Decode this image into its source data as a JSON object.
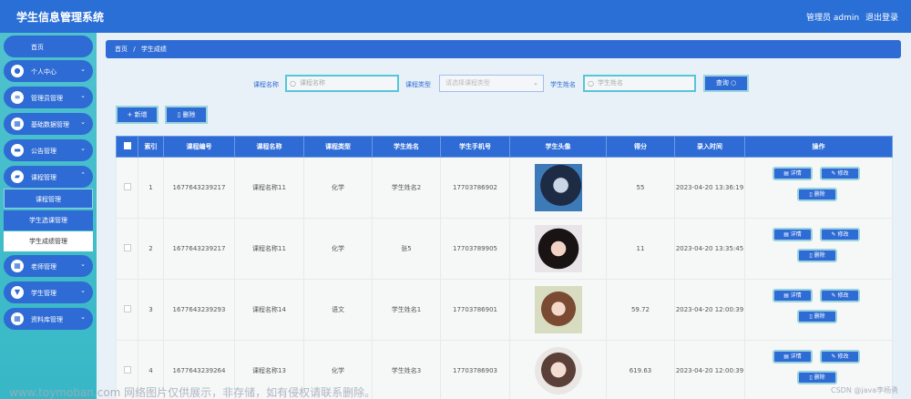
{
  "app": {
    "title": "学生信息管理系统",
    "user": "管理员 admin",
    "logout": "退出登录"
  },
  "sidebar": {
    "home": "首页",
    "items": [
      {
        "label": "个人中心"
      },
      {
        "label": "管理员管理"
      },
      {
        "label": "基础数据管理"
      },
      {
        "label": "公告管理"
      },
      {
        "label": "课程管理"
      },
      {
        "label": "老师管理"
      },
      {
        "label": "学生管理"
      },
      {
        "label": "资料库管理"
      }
    ],
    "subitems": [
      {
        "label": "课程管理"
      },
      {
        "label": "学生选课管理"
      },
      {
        "label": "学生成绩管理"
      }
    ]
  },
  "breadcrumb": {
    "home": "首页",
    "sep": "/",
    "current": "学生成绩"
  },
  "filters": {
    "course_name_label": "课程名称",
    "course_name_placeholder": "课程名称",
    "course_type_label": "课程类型",
    "course_type_placeholder": "请选择课程类型",
    "student_name_label": "学生姓名",
    "student_name_placeholder": "学生姓名",
    "query_button": "查询"
  },
  "actions": {
    "add": "+ 新增",
    "delete": "删除"
  },
  "table": {
    "headers": [
      "索引",
      "课程编号",
      "课程名称",
      "课程类型",
      "学生姓名",
      "学生手机号",
      "学生头像",
      "得分",
      "录入时间",
      "操作"
    ],
    "row_actions": {
      "detail": "详情",
      "edit": "修改",
      "delete": "删除"
    },
    "rows": [
      {
        "index": "1",
        "code": "1677643239217",
        "name": "课程名称11",
        "type": "化学",
        "student": "学生姓名2",
        "phone": "17703786902",
        "score": "55",
        "time": "2023-04-20 13:36:19"
      },
      {
        "index": "2",
        "code": "1677643239217",
        "name": "课程名称11",
        "type": "化学",
        "student": "张5",
        "phone": "17703789905",
        "score": "11",
        "time": "2023-04-20 13:35:45"
      },
      {
        "index": "3",
        "code": "1677643239293",
        "name": "课程名称14",
        "type": "语文",
        "student": "学生姓名1",
        "phone": "17703786901",
        "score": "59.72",
        "time": "2023-04-20 12:00:39"
      },
      {
        "index": "4",
        "code": "1677643239264",
        "name": "课程名称13",
        "type": "化学",
        "student": "学生姓名3",
        "phone": "17703786903",
        "score": "619.63",
        "time": "2023-04-20 12:00:39"
      }
    ]
  },
  "watermark": {
    "main": "www.toymoban.com 网络图片仅供展示，非存储，如有侵权请联系删除。",
    "corner": "CSDN @java李杨勇"
  }
}
